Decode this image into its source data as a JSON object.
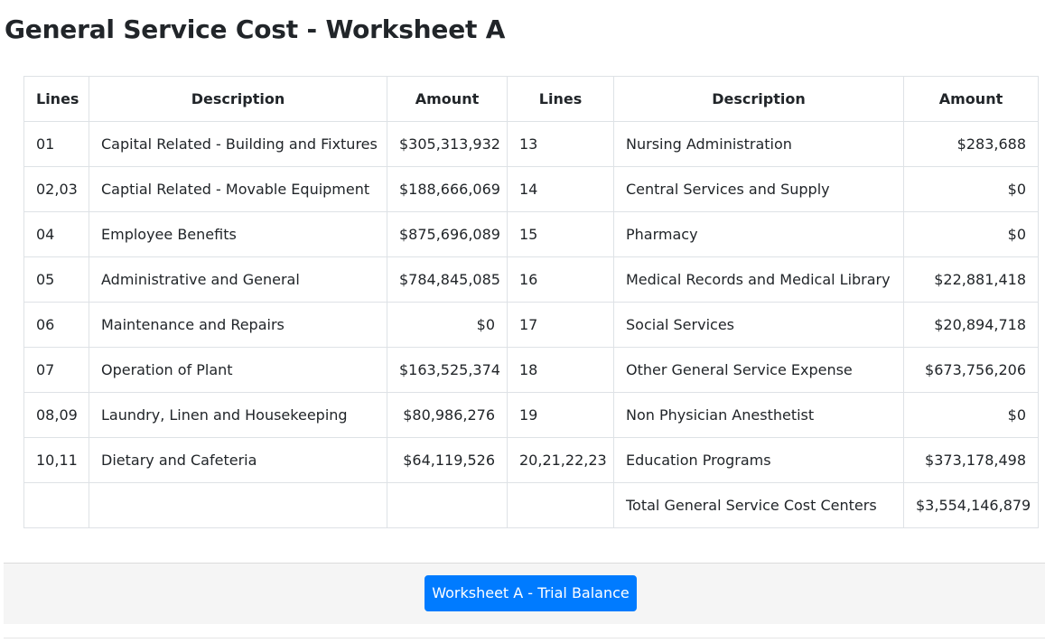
{
  "page": {
    "title": "General Service Cost - Worksheet A"
  },
  "table": {
    "headers": [
      "Lines",
      "Description",
      "Amount",
      "Lines",
      "Description",
      "Amount"
    ],
    "rows": [
      [
        "01",
        "Capital Related - Building and Fixtures",
        "$305,313,932",
        "13",
        "Nursing Administration",
        "$283,688"
      ],
      [
        "02,03",
        "Captial Related - Movable Equipment",
        "$188,666,069",
        "14",
        "Central Services and Supply",
        "$0"
      ],
      [
        "04",
        "Employee Benefits",
        "$875,696,089",
        "15",
        "Pharmacy",
        "$0"
      ],
      [
        "05",
        "Administrative and General",
        "$784,845,085",
        "16",
        "Medical Records and Medical Library",
        "$22,881,418"
      ],
      [
        "06",
        "Maintenance and Repairs",
        "$0",
        "17",
        "Social Services",
        "$20,894,718"
      ],
      [
        "07",
        "Operation of Plant",
        "$163,525,374",
        "18",
        "Other General Service Expense",
        "$673,756,206"
      ],
      [
        "08,09",
        "Laundry, Linen and Housekeeping",
        "$80,986,276",
        "19",
        "Non Physician Anesthetist",
        "$0"
      ],
      [
        "10,11",
        "Dietary and Cafeteria",
        "$64,119,526",
        "20,21,22,23",
        "Education Programs",
        "$373,178,498"
      ],
      [
        "",
        "",
        "",
        "",
        "Total General Service Cost Centers",
        "$3,554,146,879"
      ]
    ]
  },
  "footer": {
    "button_label": "Worksheet A - Trial Balance"
  },
  "colors": {
    "primary": "#007bff",
    "footer_bg": "#f5f5f5",
    "border": "#dee2e6"
  }
}
